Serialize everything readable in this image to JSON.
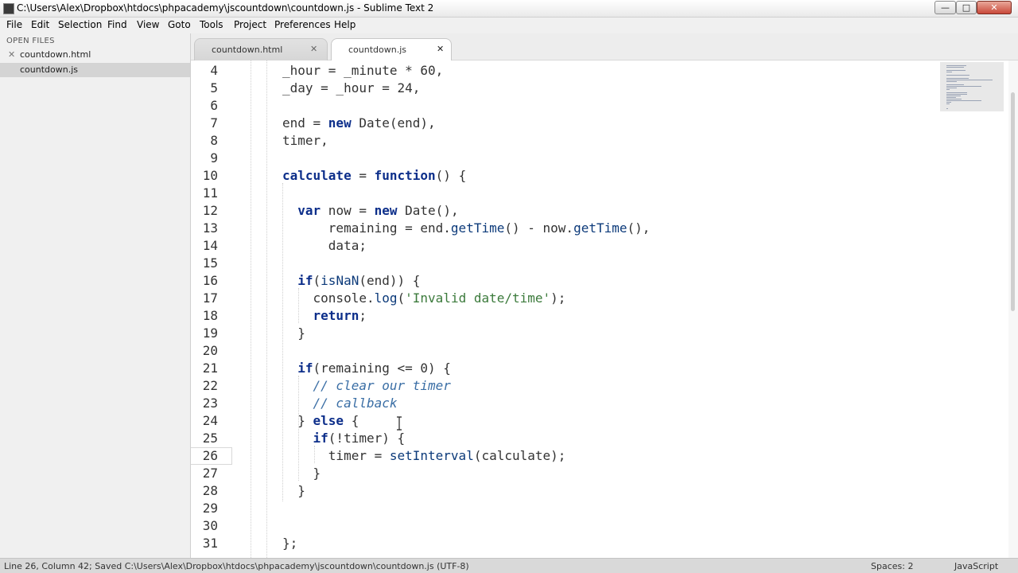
{
  "window": {
    "title": "C:\\Users\\Alex\\Dropbox\\htdocs\\phpacademy\\jscountdown\\countdown.js - Sublime Text 2",
    "minimize_glyph": "—",
    "maximize_glyph": "□",
    "close_glyph": "✕"
  },
  "menu": [
    "File",
    "Edit",
    "Selection",
    "Find",
    "View",
    "Goto",
    "Tools",
    "Project",
    "Preferences",
    "Help"
  ],
  "sidebar": {
    "header": "OPEN FILES",
    "files": [
      {
        "name": "countdown.html",
        "close": "✕",
        "selected": false
      },
      {
        "name": "countdown.js",
        "close": "",
        "selected": true
      }
    ]
  },
  "tabs": [
    {
      "label": "countdown.html",
      "close": "✕",
      "active": false
    },
    {
      "label": "countdown.js",
      "close": "✕",
      "active": true
    }
  ],
  "editor": {
    "current_line": 26,
    "line_numbers": [
      "4",
      "5",
      "6",
      "7",
      "8",
      "9",
      "10",
      "11",
      "12",
      "13",
      "14",
      "15",
      "16",
      "17",
      "18",
      "19",
      "20",
      "21",
      "22",
      "23",
      "24",
      "25",
      "26",
      "27",
      "28",
      "29",
      "30",
      "31"
    ],
    "code_lines": [
      [
        {
          "t": "_hour = _minute * 60,",
          "c": ""
        }
      ],
      [
        {
          "t": "_day = _hour = 24,",
          "c": ""
        }
      ],
      [],
      [
        {
          "t": "end = ",
          "c": ""
        },
        {
          "t": "new",
          "c": "kw"
        },
        {
          "t": " Date(end),",
          "c": ""
        }
      ],
      [
        {
          "t": "timer,",
          "c": ""
        }
      ],
      [],
      [
        {
          "t": "calculate",
          "c": "fnb"
        },
        {
          "t": " = ",
          "c": ""
        },
        {
          "t": "function",
          "c": "kw"
        },
        {
          "t": "() {",
          "c": ""
        }
      ],
      [],
      [
        {
          "t": "  ",
          "c": ""
        },
        {
          "t": "var",
          "c": "kw"
        },
        {
          "t": " now = ",
          "c": ""
        },
        {
          "t": "new",
          "c": "kw"
        },
        {
          "t": " Date(),",
          "c": ""
        }
      ],
      [
        {
          "t": "      remaining = end.",
          "c": ""
        },
        {
          "t": "getTime",
          "c": "fn"
        },
        {
          "t": "() - now.",
          "c": ""
        },
        {
          "t": "getTime",
          "c": "fn"
        },
        {
          "t": "(),",
          "c": ""
        }
      ],
      [
        {
          "t": "      data;",
          "c": ""
        }
      ],
      [],
      [
        {
          "t": "  ",
          "c": ""
        },
        {
          "t": "if",
          "c": "kw"
        },
        {
          "t": "(",
          "c": ""
        },
        {
          "t": "isNaN",
          "c": "fn"
        },
        {
          "t": "(end)) {",
          "c": ""
        }
      ],
      [
        {
          "t": "    console.",
          "c": ""
        },
        {
          "t": "log",
          "c": "fn"
        },
        {
          "t": "(",
          "c": ""
        },
        {
          "t": "'Invalid date/time'",
          "c": "str"
        },
        {
          "t": ");",
          "c": ""
        }
      ],
      [
        {
          "t": "    ",
          "c": ""
        },
        {
          "t": "return",
          "c": "kw"
        },
        {
          "t": ";",
          "c": ""
        }
      ],
      [
        {
          "t": "  }",
          "c": ""
        }
      ],
      [],
      [
        {
          "t": "  ",
          "c": ""
        },
        {
          "t": "if",
          "c": "kw"
        },
        {
          "t": "(remaining <= 0) {",
          "c": ""
        }
      ],
      [
        {
          "t": "    ",
          "c": ""
        },
        {
          "t": "// clear our timer",
          "c": "cmt"
        }
      ],
      [
        {
          "t": "    ",
          "c": ""
        },
        {
          "t": "// callback",
          "c": "cmt"
        }
      ],
      [
        {
          "t": "  } ",
          "c": ""
        },
        {
          "t": "else",
          "c": "kw"
        },
        {
          "t": " {",
          "c": ""
        }
      ],
      [
        {
          "t": "    ",
          "c": ""
        },
        {
          "t": "if",
          "c": "kw"
        },
        {
          "t": "(!timer) {",
          "c": ""
        }
      ],
      [
        {
          "t": "      timer = ",
          "c": ""
        },
        {
          "t": "setInterval",
          "c": "fn"
        },
        {
          "t": "(calculate);",
          "c": ""
        }
      ],
      [
        {
          "t": "    }",
          "c": ""
        }
      ],
      [
        {
          "t": "  }",
          "c": ""
        }
      ],
      [],
      [],
      [
        {
          "t": "};",
          "c": ""
        }
      ]
    ]
  },
  "statusbar": {
    "left": "Line 26, Column 42; Saved C:\\Users\\Alex\\Dropbox\\htdocs\\phpacademy\\jscountdown\\countdown.js (UTF-8)",
    "spaces": "Spaces: 2",
    "syntax": "JavaScript"
  }
}
